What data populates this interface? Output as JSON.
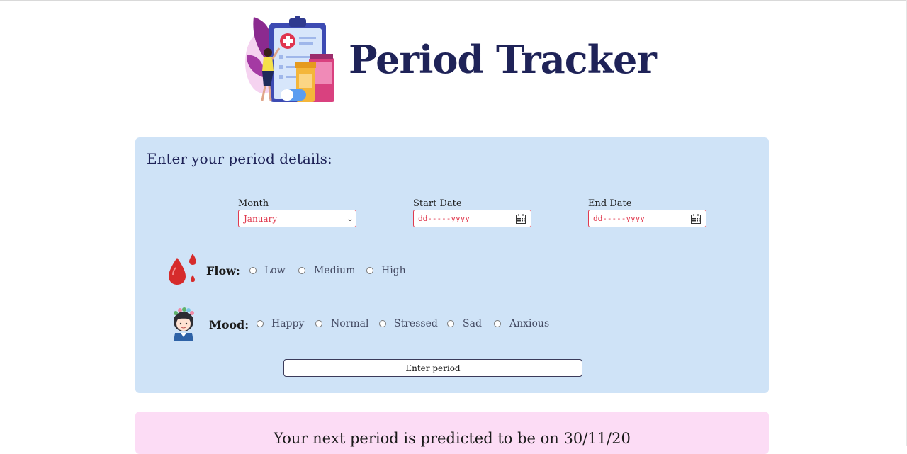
{
  "header": {
    "title": "Period Tracker",
    "illustration": "clipboard-doctor-illustration"
  },
  "form": {
    "heading": "Enter your period details:",
    "month": {
      "label": "Month",
      "value": "January"
    },
    "start_date": {
      "label": "Start Date",
      "placeholder": "dd-----yyyy"
    },
    "end_date": {
      "label": "End Date",
      "placeholder": "dd-----yyyy"
    },
    "flow": {
      "label": "Flow:",
      "icon": "blood-drops-icon",
      "options": [
        "Low",
        "Medium",
        "High"
      ]
    },
    "mood": {
      "label": "Mood:",
      "icon": "girl-flower-crown-icon",
      "options": [
        "Happy",
        "Normal",
        "Stressed",
        "Sad",
        "Anxious"
      ]
    },
    "submit_label": "Enter period"
  },
  "prediction": {
    "text": "Your next period is predicted to be on 30/11/20"
  },
  "colors": {
    "form_bg": "#cfe3f7",
    "prediction_bg": "#fcdcf5",
    "input_border": "#e03a4f",
    "title": "#1f2358"
  }
}
